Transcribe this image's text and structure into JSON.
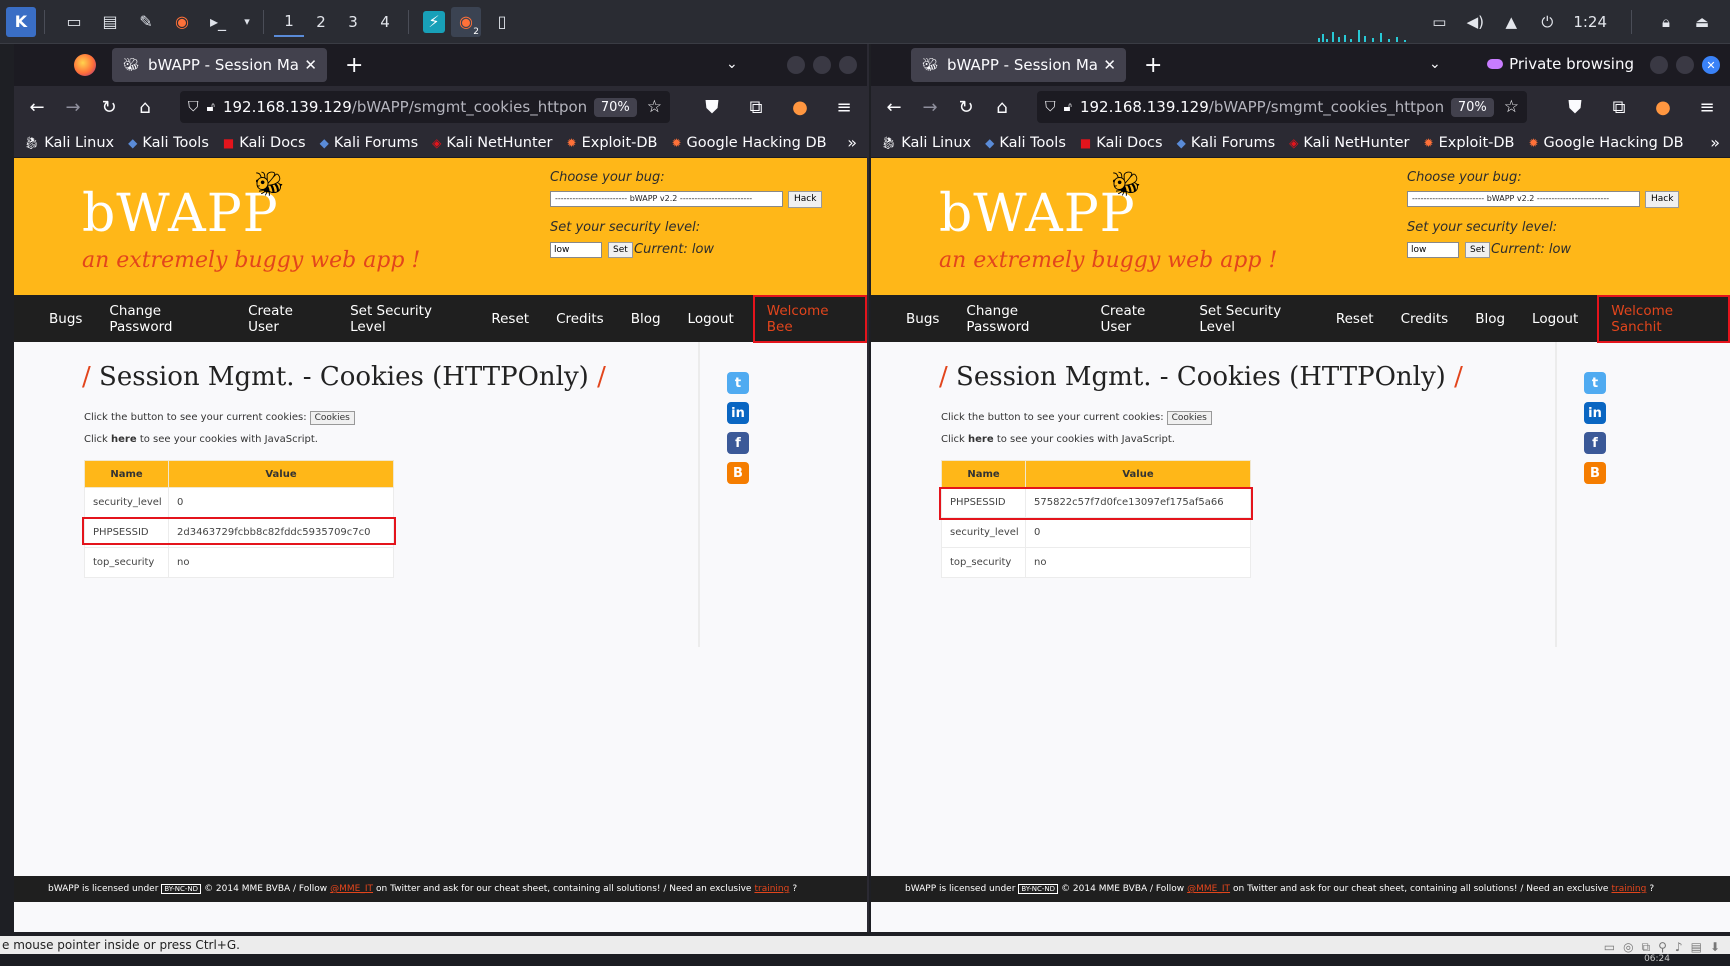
{
  "panel": {
    "workspaces": [
      "1",
      "2",
      "3",
      "4"
    ],
    "time": "1:24",
    "badge_count": "2"
  },
  "windows": [
    {
      "tab_title": "bWAPP - Session Manage",
      "url_host": "192.168.139.129",
      "url_path": "/bWAPP/smgmt_cookies_httponly",
      "zoom": "70%",
      "private_label": "",
      "welcome": "Welcome Bee",
      "cookies": [
        {
          "name": "security_level",
          "value": "0"
        },
        {
          "name": "PHPSESSID",
          "value": "2d3463729fcbb8c82fddc5935709c7c0"
        },
        {
          "name": "top_security",
          "value": "no"
        }
      ]
    },
    {
      "tab_title": "bWAPP - Session Manage",
      "url_host": "192.168.139.129",
      "url_path": "/bWAPP/smgmt_cookies_httponly",
      "zoom": "70%",
      "private_label": "Private browsing",
      "welcome": "Welcome Sanchit",
      "cookies": [
        {
          "name": "PHPSESSID",
          "value": "575822c57f7d0fce13097ef175af5a66"
        },
        {
          "name": "security_level",
          "value": "0"
        },
        {
          "name": "top_security",
          "value": "no"
        }
      ]
    }
  ],
  "bookmarks": [
    "Kali Linux",
    "Kali Tools",
    "Kali Docs",
    "Kali Forums",
    "Kali NetHunter",
    "Exploit-DB",
    "Google Hacking DB"
  ],
  "bwapp": {
    "logo": "bWAPP",
    "tagline": "an extremely buggy web app !",
    "choose_label": "Choose your bug:",
    "bug_select": "------------------------- bWAPP v2.2 -------------------------",
    "hack_label": "Hack",
    "security_label": "Set your security level:",
    "security_value": "low",
    "set_label": "Set",
    "current_label": "Current: low",
    "menu": [
      "Bugs",
      "Change Password",
      "Create User",
      "Set Security Level",
      "Reset",
      "Credits",
      "Blog",
      "Logout"
    ],
    "heading_title": "Session Mgmt. - Cookies (HTTPOnly)",
    "slash": "/",
    "cookies_text": "Click the button to see your current cookies:",
    "cookies_button": "Cookies",
    "js_prefix": "Click",
    "js_link": "here",
    "js_suffix": "to see your cookies with JavaScript.",
    "col_name": "Name",
    "col_value": "Value",
    "footer_a": "bWAPP is licensed under",
    "footer_cc": "BY-NC-ND",
    "footer_b": "© 2014 MME BVBA / Follow",
    "footer_twitter": "@MME_IT",
    "footer_c": "on Twitter and ask for our cheat sheet, containing all solutions! / Need an exclusive",
    "footer_training": "training",
    "footer_end": "?"
  },
  "statusbar": {
    "text": "e mouse pointer inside or press Ctrl+G."
  },
  "taskbar": {
    "time": "06:24"
  }
}
